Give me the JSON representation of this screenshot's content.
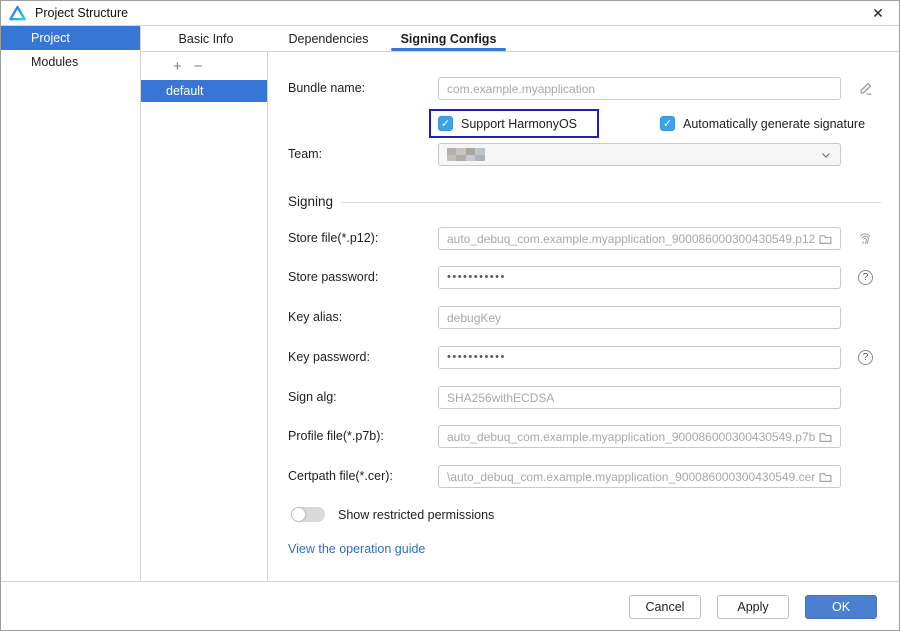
{
  "window": {
    "title": "Project Structure"
  },
  "icons": {
    "close": "✕",
    "check": "✓",
    "plus": "+",
    "minus": "−",
    "help": "?"
  },
  "sidebar": {
    "items": [
      {
        "label": "Project",
        "selected": true
      },
      {
        "label": "Modules",
        "selected": false
      }
    ]
  },
  "tabs": [
    {
      "label": "Basic Info",
      "selected": false
    },
    {
      "label": "Dependencies",
      "selected": false
    },
    {
      "label": "Signing Configs",
      "selected": true
    }
  ],
  "config_list": {
    "items": [
      {
        "label": "default",
        "selected": true
      }
    ]
  },
  "form": {
    "bundle_name": {
      "label": "Bundle name:",
      "value": "com.example.myapplication"
    },
    "support_harmonyos": {
      "label": "Support HarmonyOS",
      "checked": true
    },
    "auto_signature": {
      "label": "Automatically generate signature",
      "checked": true
    },
    "team": {
      "label": "Team:",
      "value_redacted": true
    },
    "signing_section_title": "Signing",
    "store_file": {
      "label": "Store file(*.p12):",
      "value": "auto_debuq_com.example.myapplication_900086000300430549.p12"
    },
    "store_password": {
      "label": "Store password:",
      "value": "•••••••••••"
    },
    "key_alias": {
      "label": "Key alias:",
      "value": "debugKey"
    },
    "key_password": {
      "label": "Key password:",
      "value": "•••••••••••"
    },
    "sign_alg": {
      "label": "Sign alg:",
      "value": "SHA256withECDSA"
    },
    "profile_file": {
      "label": "Profile file(*.p7b):",
      "value": "auto_debuq_com.example.myapplication_900086000300430549.p7b"
    },
    "certpath_file": {
      "label": "Certpath file(*.cer):",
      "value": "\\auto_debuq_com.example.myapplication_900086000300430549.cer"
    },
    "show_restricted": {
      "label": "Show restricted permissions",
      "on": false
    },
    "guide_link": "View the operation guide"
  },
  "footer": {
    "cancel": "Cancel",
    "apply": "Apply",
    "ok": "OK"
  },
  "colors": {
    "selection_blue": "#3876d6",
    "tab_underline": "#3b77d9",
    "checkbox_blue": "#3fa0e6",
    "highlight_border": "#1c22b8",
    "ok_button": "#4b80d1",
    "link": "#2f6fc1"
  }
}
